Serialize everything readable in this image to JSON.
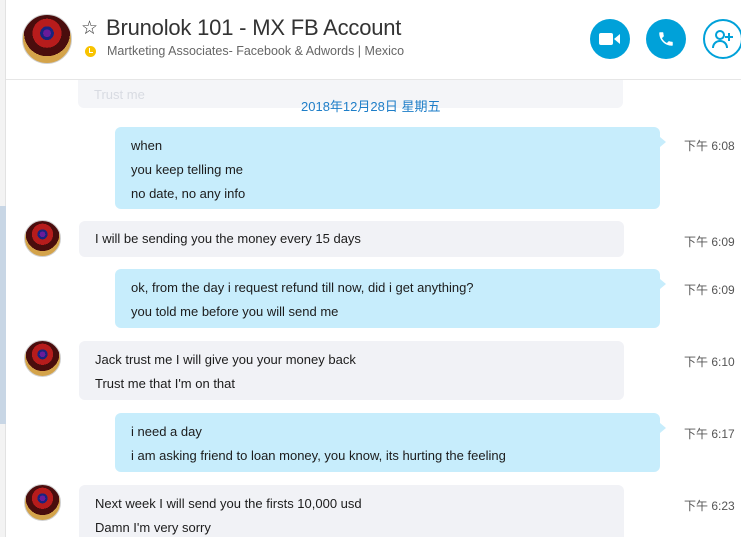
{
  "header": {
    "title": "Brunolok 101 - MX FB Account",
    "subtitle": "Martketing Associates- Facebook & Adwords  |  Mexico",
    "buttons": {
      "video": "video-call",
      "call": "voice-call",
      "add": "add-people"
    }
  },
  "colors": {
    "accent": "#00a1d9",
    "outgoing_bubble": "#c7edfc",
    "incoming_bubble": "#f1f2f6",
    "status": "#f8c300",
    "date": "#1e7ec8"
  },
  "chat": {
    "ghost_text": "Trust me",
    "date_divider": "2018年12月28日 星期五",
    "messages": [
      {
        "direction": "out",
        "lines": [
          "when",
          "you keep telling me",
          "no date, no any info"
        ],
        "time": "下午 6:08"
      },
      {
        "direction": "in",
        "lines": [
          "I will be sending you the money every 15 days"
        ],
        "time": "下午 6:09"
      },
      {
        "direction": "out",
        "lines": [
          "ok, from the day i request refund till now, did i get anything?",
          "you told me before you will send me"
        ],
        "time": "下午 6:09"
      },
      {
        "direction": "in",
        "lines": [
          "Jack trust me I will give you your money back",
          "Trust me that I'm on that"
        ],
        "time": "下午 6:10"
      },
      {
        "direction": "out",
        "lines": [
          "i need a day",
          "i am asking friend to loan money, you know, its hurting the feeling"
        ],
        "time": "下午 6:17"
      },
      {
        "direction": "in",
        "lines": [
          "Next week I will send you the firsts 10,000 usd",
          "Damn I'm very sorry"
        ],
        "time": "下午 6:23"
      }
    ]
  }
}
